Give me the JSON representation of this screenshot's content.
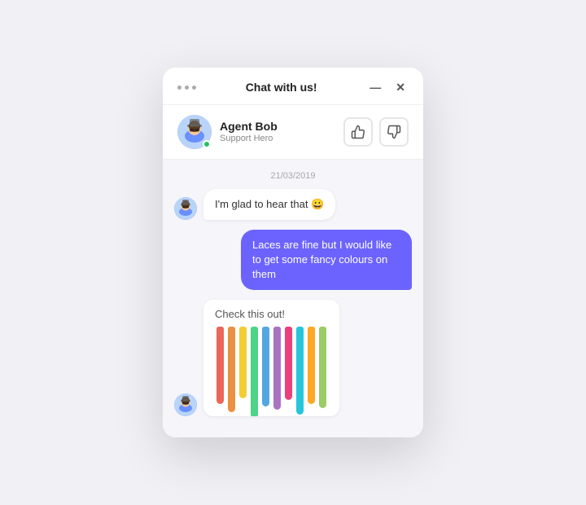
{
  "window": {
    "title": "Chat with us!",
    "minimize_label": "—",
    "close_label": "✕"
  },
  "agent": {
    "name": "Agent Bob",
    "title": "Support Hero",
    "avatar_emoji": "🧑‍🦳",
    "online": true,
    "thumbs_up": "👍",
    "thumbs_down": "👎"
  },
  "chat": {
    "date_divider": "21/03/2019",
    "messages": [
      {
        "id": "msg1",
        "type": "agent",
        "text": "I'm glad to hear that 😀",
        "avatar_emoji": "🧑‍🦳"
      },
      {
        "id": "msg2",
        "type": "user",
        "text": "Laces are fine but I would like to get some fancy colours on them"
      },
      {
        "id": "msg3",
        "type": "agent",
        "text": "Check this out!",
        "avatar_emoji": "🧑‍🦳",
        "has_image": true
      }
    ],
    "laces": [
      {
        "color": "#e74c3c"
      },
      {
        "color": "#e67e22"
      },
      {
        "color": "#f1c40f"
      },
      {
        "color": "#2ecc71"
      },
      {
        "color": "#3498db"
      },
      {
        "color": "#9b59b6"
      },
      {
        "color": "#e91e63"
      },
      {
        "color": "#00bcd4"
      },
      {
        "color": "#ff9800"
      },
      {
        "color": "#8bc34a"
      }
    ]
  },
  "dots": [
    "dot1",
    "dot2",
    "dot3"
  ]
}
